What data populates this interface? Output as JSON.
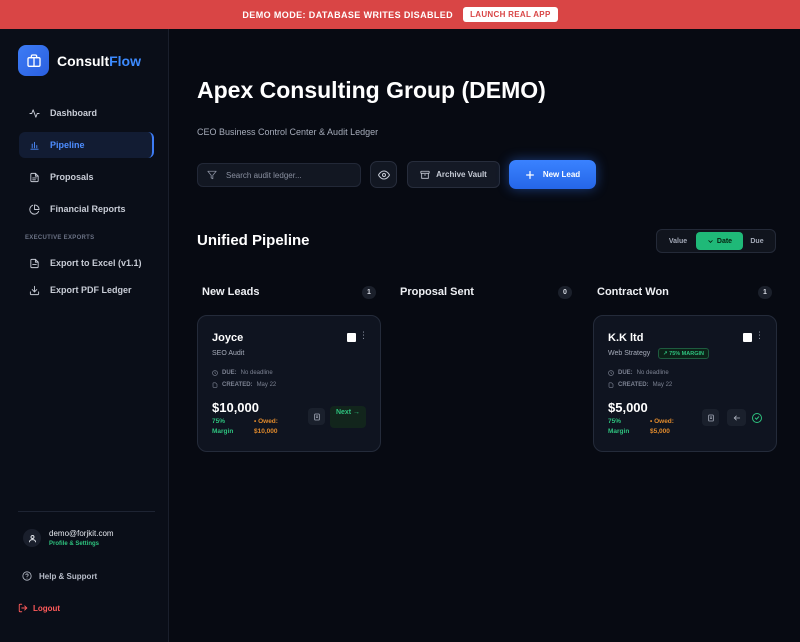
{
  "banner": {
    "text": "DEMO MODE: DATABASE WRITES DISABLED",
    "button": "LAUNCH REAL APP"
  },
  "brand": {
    "name_part1": "Consult",
    "name_part2": "Flow"
  },
  "sidebar": {
    "items": [
      {
        "label": "Dashboard",
        "icon": "activity-icon"
      },
      {
        "label": "Pipeline",
        "icon": "bar-chart-icon",
        "active": true
      },
      {
        "label": "Proposals",
        "icon": "document-icon"
      },
      {
        "label": "Financial Reports",
        "icon": "pie-chart-icon"
      }
    ],
    "exports_label": "EXECUTIVE EXPORTS",
    "exports": [
      {
        "label": "Export to Excel (v1.1)",
        "icon": "file-icon"
      },
      {
        "label": "Export PDF Ledger",
        "icon": "download-icon"
      }
    ],
    "user": {
      "email": "demo@forjkit.com",
      "settings": "Profile & Settings"
    },
    "help": "Help & Support",
    "logout": "Logout"
  },
  "header": {
    "title": "Apex Consulting Group (DEMO)",
    "subtitle": "CEO Business Control Center & Audit Ledger"
  },
  "toolbar": {
    "search_placeholder": "Search audit ledger...",
    "archive": "Archive Vault",
    "new_lead": "New Lead"
  },
  "pipeline": {
    "title": "Unified Pipeline",
    "sort": {
      "options": [
        "Value",
        "Date",
        "Due"
      ],
      "active": "Date"
    },
    "columns": [
      {
        "title": "New Leads",
        "count": "1"
      },
      {
        "title": "Proposal Sent",
        "count": "0"
      },
      {
        "title": "Contract Won",
        "count": "1"
      }
    ],
    "cards": [
      {
        "name": "Joyce",
        "service": "SEO Audit",
        "due_label": "DUE:",
        "due": "No deadline",
        "created_label": "CREATED:",
        "created": "May 22",
        "amount": "$10,000",
        "margin": "75% Margin",
        "owed": "• Owed: $10,000",
        "action": "Next →"
      },
      {
        "name": "K.K ltd",
        "service": "Web Strategy",
        "badge": "↗ 75% MARGIN",
        "due_label": "DUE:",
        "due": "No deadline",
        "created_label": "CREATED:",
        "created": "May 22",
        "amount": "$5,000",
        "margin": "75% Margin",
        "owed": "• Owed: $5,000"
      }
    ]
  },
  "colors": {
    "accent": "#3d7cf5",
    "success": "#2ec27e",
    "danger": "#d94545",
    "warning": "#e08a2c",
    "background": "#070a12"
  }
}
